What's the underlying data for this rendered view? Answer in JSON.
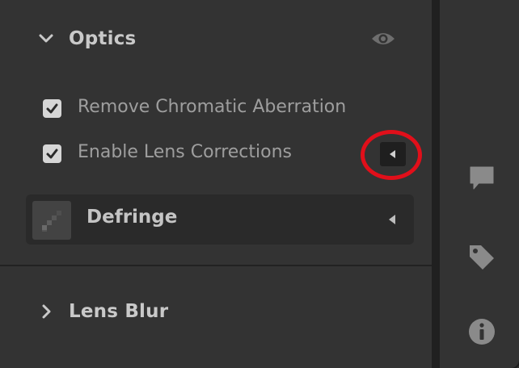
{
  "optics": {
    "title": "Optics",
    "checkboxes": [
      {
        "label": "Remove Chromatic Aberration",
        "checked": true
      },
      {
        "label": "Enable Lens Corrections",
        "checked": true
      }
    ],
    "defringe_label": "Defringe"
  },
  "lens_blur": {
    "title": "Lens Blur"
  },
  "colors": {
    "panel": "#333333",
    "annotation": "#e10f1a",
    "text": "#c9c9c9"
  },
  "icons": [
    "chevron-down-icon",
    "eye-icon",
    "checkmark-icon",
    "disclosure-left-icon",
    "defringe-icon",
    "chevron-right-icon",
    "comment-icon",
    "tag-icon",
    "info-icon"
  ]
}
